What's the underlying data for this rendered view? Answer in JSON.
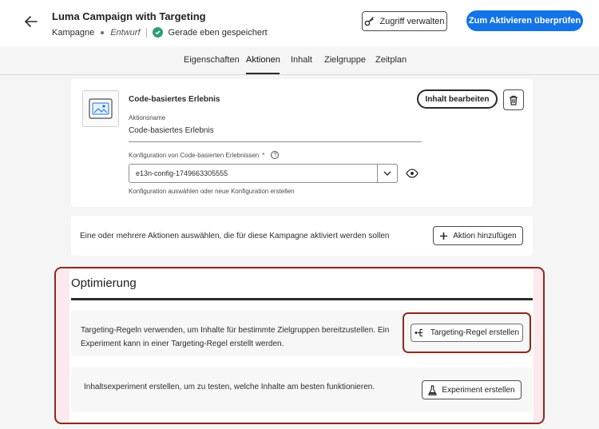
{
  "header": {
    "back_icon": "arrow-left-icon",
    "title": "Luma Campaign with Targeting",
    "type_label": "Kampagne",
    "status": "Entwurf",
    "saved_text": "Gerade eben gespeichert",
    "manage_access_label": "Zugriff verwalten",
    "review_label": "Zum Aktivieren überprüfen"
  },
  "tabs": [
    "Eigenschaften",
    "Aktionen",
    "Inhalt",
    "Zielgruppe",
    "Zeitplan"
  ],
  "active_tab": "Aktionen",
  "action_card": {
    "title": "Code-basiertes Erlebnis",
    "name_label": "Aktionsname",
    "name_value": "Code-basiertes Erlebnis",
    "config_label": "Konfiguration von Code-basierten Erlebnissen",
    "config_required": "*",
    "config_value": "e13n-config-1749663305555",
    "config_help": "Konfiguration auswählen oder neue Konfiguration erstellen",
    "edit_content_label": "Inhalt bearbeiten"
  },
  "add_action_card": {
    "text": "Eine oder mehrere Aktionen auswählen, die für diese Kampagne aktiviert werden sollen",
    "button_label": "Aktion hinzufügen"
  },
  "optimization": {
    "title": "Optimierung",
    "targeting_text": "Targeting-Regeln verwenden, um Inhalte für bestimmte Zielgruppen bereitzustellen. Ein Experiment kann in einer Targeting-Regel erstellt werden.",
    "targeting_button": "Targeting-Regel erstellen",
    "experiment_text": "Inhaltsexperiment erstellen, um zu testen, welche Inhalte am besten funktionieren.",
    "experiment_button": "Experiment erstellen"
  },
  "colors": {
    "primary": "#1473e6",
    "highlight": "#8b2a1e",
    "saved_check": "#2d9d78"
  }
}
